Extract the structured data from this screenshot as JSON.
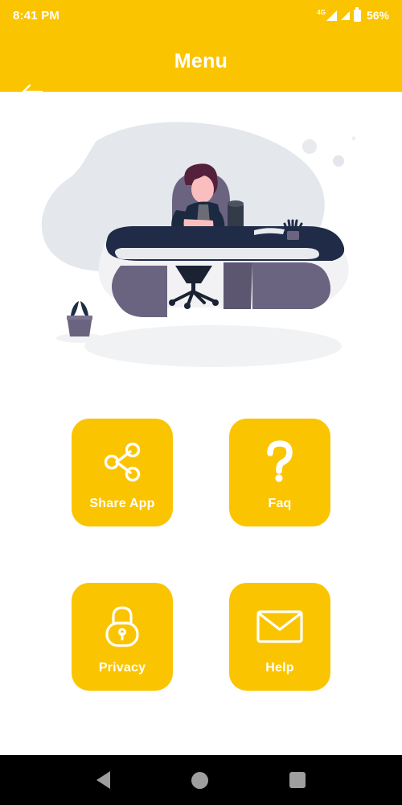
{
  "status_bar": {
    "time": "8:41 PM",
    "network_label": "4G",
    "battery_percent": "56%",
    "icons": [
      "signal-4g-icon",
      "signal-bars-icon",
      "battery-icon"
    ]
  },
  "app_bar": {
    "title": "Menu",
    "back_icon": "arrow-left-icon",
    "background_color": "#FBC400",
    "text_color": "#FFFFFF"
  },
  "illustration": {
    "name": "person-working-at-desk-illustration",
    "alt": "Illustration of a person seated at a curved office desk with a plant and speaker",
    "colors": {
      "blob": "#E4E7EB",
      "desk_top": "#1F2B47",
      "desk_edge": "#F2F2F4",
      "panel": "#6B6480",
      "panel_dark": "#5C5670",
      "hair": "#55203C",
      "skin": "#FBBEBE",
      "jacket": "#1B2A40",
      "shirt": "#6C6C77"
    }
  },
  "menu": {
    "items": [
      {
        "label": "Share App",
        "icon": "share-icon",
        "name": "menu-tile-share-app"
      },
      {
        "label": "Faq",
        "icon": "question-mark-icon",
        "name": "menu-tile-faq"
      },
      {
        "label": "Privacy",
        "icon": "lock-icon",
        "name": "menu-tile-privacy"
      },
      {
        "label": "Help",
        "icon": "envelope-icon",
        "name": "menu-tile-help"
      }
    ],
    "tile_color": "#FBC400",
    "label_color": "#FFFFFF"
  },
  "navigation_bar": {
    "buttons": [
      {
        "name": "nav-back-button",
        "icon": "triangle-left-icon"
      },
      {
        "name": "nav-home-button",
        "icon": "circle-icon"
      },
      {
        "name": "nav-recents-button",
        "icon": "square-icon"
      }
    ],
    "background_color": "#000000",
    "icon_color": "#9E9E9E"
  }
}
